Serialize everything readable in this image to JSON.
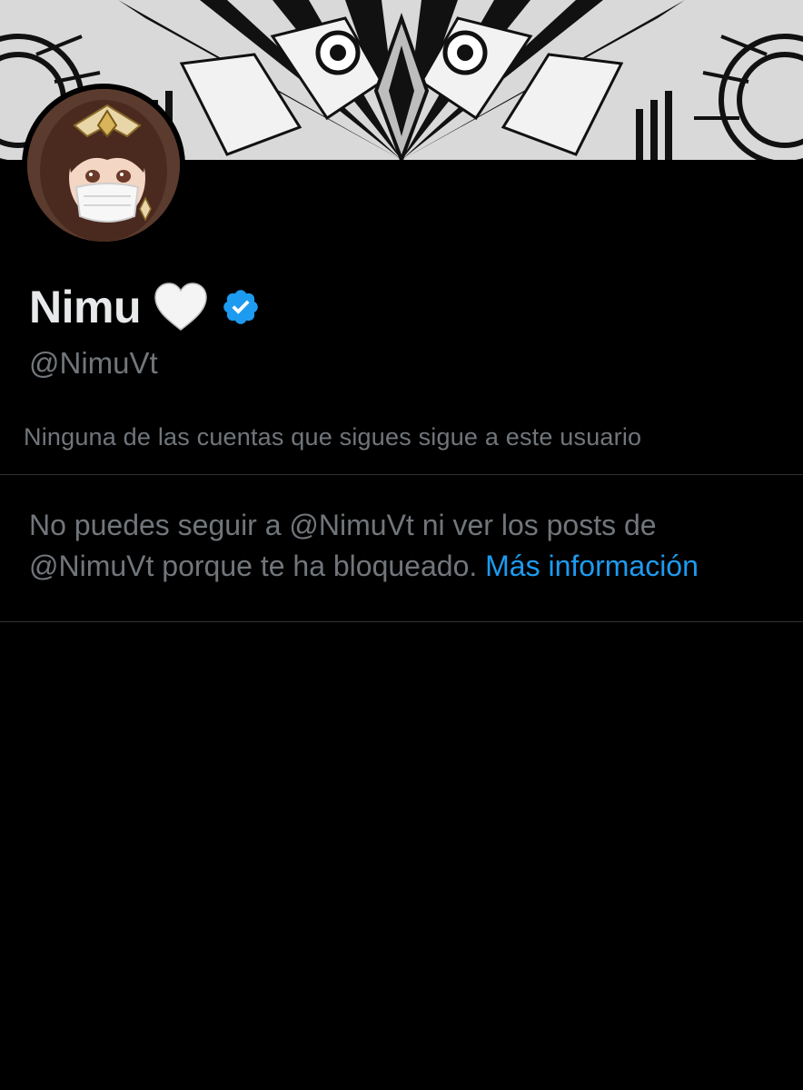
{
  "profile": {
    "display_name": "Nimu",
    "handle": "@NimuVt",
    "emoji": "heart-emoji-white",
    "verified": true,
    "verified_color": "#1d9bf0"
  },
  "followers_note": "Ninguna de las cuentas que sigues sigue a este usuario",
  "blocked": {
    "line1": "No puedes seguir a @NimuVt ni ver los posts de",
    "line2": "@NimuVt porque te ha bloqueado.",
    "link_label": "Más información"
  },
  "colors": {
    "background": "#000000",
    "primary_text": "#e7e9ea",
    "secondary_text": "#71767b",
    "accent": "#1d9bf0",
    "divider": "#2f3336"
  },
  "icons": {
    "banner": "ornamental-mask-banner-image",
    "avatar": "masked-girl-avatar-image",
    "heart": "white-heart-icon",
    "verified": "verified-badge-icon"
  }
}
